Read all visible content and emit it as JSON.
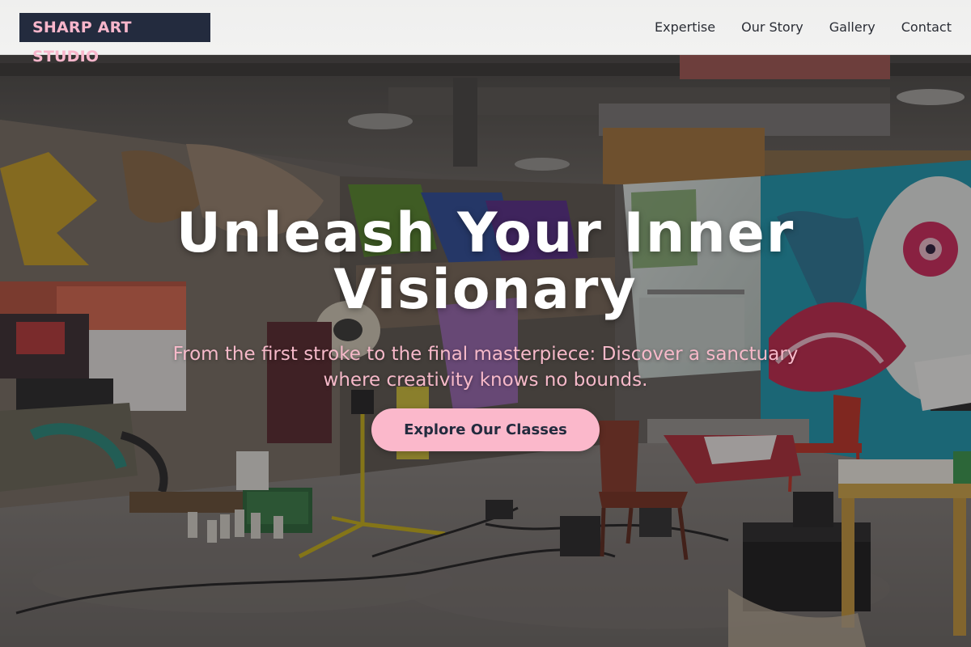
{
  "brand": {
    "name": "SHARP ART STUDIO",
    "logo_bg": "#232b3e",
    "logo_text_color": "#f8b6cb"
  },
  "nav": {
    "links": [
      {
        "label": "Expertise"
      },
      {
        "label": "Our Story"
      },
      {
        "label": "Gallery"
      },
      {
        "label": "Contact"
      }
    ]
  },
  "hero": {
    "background_alt": "graffiti-filled art studio interior",
    "title": "Unleash Your Inner Visionary",
    "subtitle": "From the first stroke to the final masterpiece: Discover a sanctuary where creativity knows no bounds.",
    "cta_label": "Explore Our Classes",
    "accent": "#fbb8cb",
    "title_color": "#ffffff"
  }
}
